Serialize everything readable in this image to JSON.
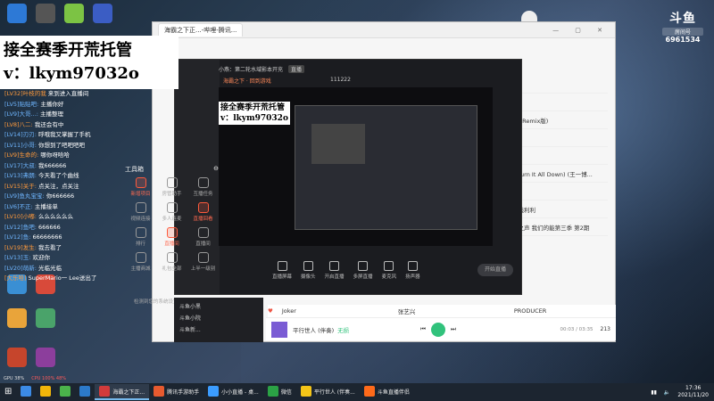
{
  "promo": {
    "line1": "接全赛季开荒托管",
    "line2": "v：lkym97032o"
  },
  "promo_small": {
    "line1": "接全赛季开荒托管",
    "line2": "v：lkym97032o"
  },
  "logo": {
    "brand": "斗鱼",
    "room_label": "房间号",
    "room_number": "6961534"
  },
  "back_window": {
    "tab_title": "海霸之下正...-哔哩-腾讯...",
    "ctrls": "— ▢ ✕"
  },
  "right_panel": {
    "items": [
      "号",
      "ㄍ",
      "时烟景 (Remix版)",
      "可C",
      "于他人",
      "烬跟 (Burn It All Down) (王一博...",
      "风拉",
      "也许在线利利",
      "唱吧子之声 我们的能第三季 第2期"
    ]
  },
  "live": {
    "host_label": "小燕：第二轮水域影本开充",
    "tag": "直播",
    "sub": "海霸之下 · 回到游戏",
    "viewers": "111222"
  },
  "tools": {
    "title": "工具箱",
    "items": [
      {
        "label": "新增项目",
        "red": true
      },
      {
        "label": "房管助手",
        "red": false
      },
      {
        "label": "互播任务",
        "red": false
      },
      {
        "label": "视频连接",
        "red": false
      },
      {
        "label": "多人连麦",
        "red": false
      },
      {
        "label": "直播回看",
        "red": true
      },
      {
        "label": "排行",
        "red": false
      },
      {
        "label": "直播间",
        "red": true
      },
      {
        "label": "直播间",
        "red": false
      },
      {
        "label": "主播商城",
        "red": false
      },
      {
        "label": "礼包全部",
        "red": false
      },
      {
        "label": "上半一级别",
        "red": false
      }
    ]
  },
  "dark_bar": {
    "buttons": [
      "直播屏幕",
      "摄像头",
      "开启直播",
      "多屏直播",
      "麦克风",
      "扬声器"
    ],
    "start_label": "开始直播"
  },
  "notice": "检测到您的系统设置已经运行",
  "left_list": {
    "items": [
      "斗鱼小黑",
      "斗鱼小院",
      "斗鱼新..."
    ]
  },
  "song_row": {
    "title": "Joker",
    "artist": "张艺兴",
    "album": "PRODUCER"
  },
  "player": {
    "song": "平行世人 (伴奏)",
    "tag": "无损",
    "time": "00:03 / 03:35",
    "queue": "213"
  },
  "chat": [
    {
      "user": "[LV32]叶枝的我",
      "msg": "来到进入直播间"
    },
    {
      "user": "[LV5]贴贴吧:",
      "msg": "主播你好"
    },
    {
      "user": "[LV9]大哥...:",
      "msg": "主播整理"
    },
    {
      "user": "[LV8]八二:",
      "msg": "我还会有中"
    },
    {
      "user": "[LV14]刃刃:",
      "msg": "呼哦我又掌握了手机"
    },
    {
      "user": "[LV11]小哥:",
      "msg": "你想到了吧吧吧吧"
    },
    {
      "user": "[LV9]生命的:",
      "msg": "哪你呀哈哈"
    },
    {
      "user": "[LV17]大叔:",
      "msg": "我666666"
    },
    {
      "user": "[LV13]弗朗:",
      "msg": "今天看了个曲线"
    },
    {
      "user": "[LV15]关于:",
      "msg": "点关注，点关注"
    },
    {
      "user": "[LV9]鱼丸宝宝:",
      "msg": "你666666"
    },
    {
      "user": "[LV6]不正:",
      "msg": "主播接单"
    },
    {
      "user": "[LV10]小嘟:",
      "msg": "么么么么么么"
    },
    {
      "user": "[LV12]鱼吧:",
      "msg": "666666"
    },
    {
      "user": "[LV12]鱼:",
      "msg": "66666666"
    },
    {
      "user": "[LV19]发生:",
      "msg": "我去看了"
    },
    {
      "user": "[LV13]玉:",
      "msg": "欢迎你"
    },
    {
      "user": "[LV20]萌新:",
      "msg": "光临光临"
    },
    {
      "user": "[大乐哈]",
      "msg": "SuperMario一 Lee送出了"
    }
  ],
  "perf": {
    "gpu": "GPU 38%",
    "fps": "CPU 100% 48%"
  },
  "taskbar": {
    "items": [
      {
        "label": "",
        "color": "#3c8be6"
      },
      {
        "label": "",
        "color": "#f1b60a"
      },
      {
        "label": "",
        "color": "#4bb34b"
      },
      {
        "label": "",
        "color": "#2c7ac9"
      },
      {
        "label": "海霸之下正...",
        "color": "#d23b3b",
        "active": true
      },
      {
        "label": "腾讯手游助手",
        "color": "#e85a2f"
      },
      {
        "label": "小小直播 - 桌...",
        "color": "#3b9cff"
      },
      {
        "label": "微信",
        "color": "#2ba245"
      },
      {
        "label": "平行世人 (伴奏...",
        "color": "#f5c518"
      },
      {
        "label": "斗鱼直播伴侣",
        "color": "#ff6a1a"
      }
    ],
    "time": "17:36",
    "date": "2021/11/20"
  }
}
